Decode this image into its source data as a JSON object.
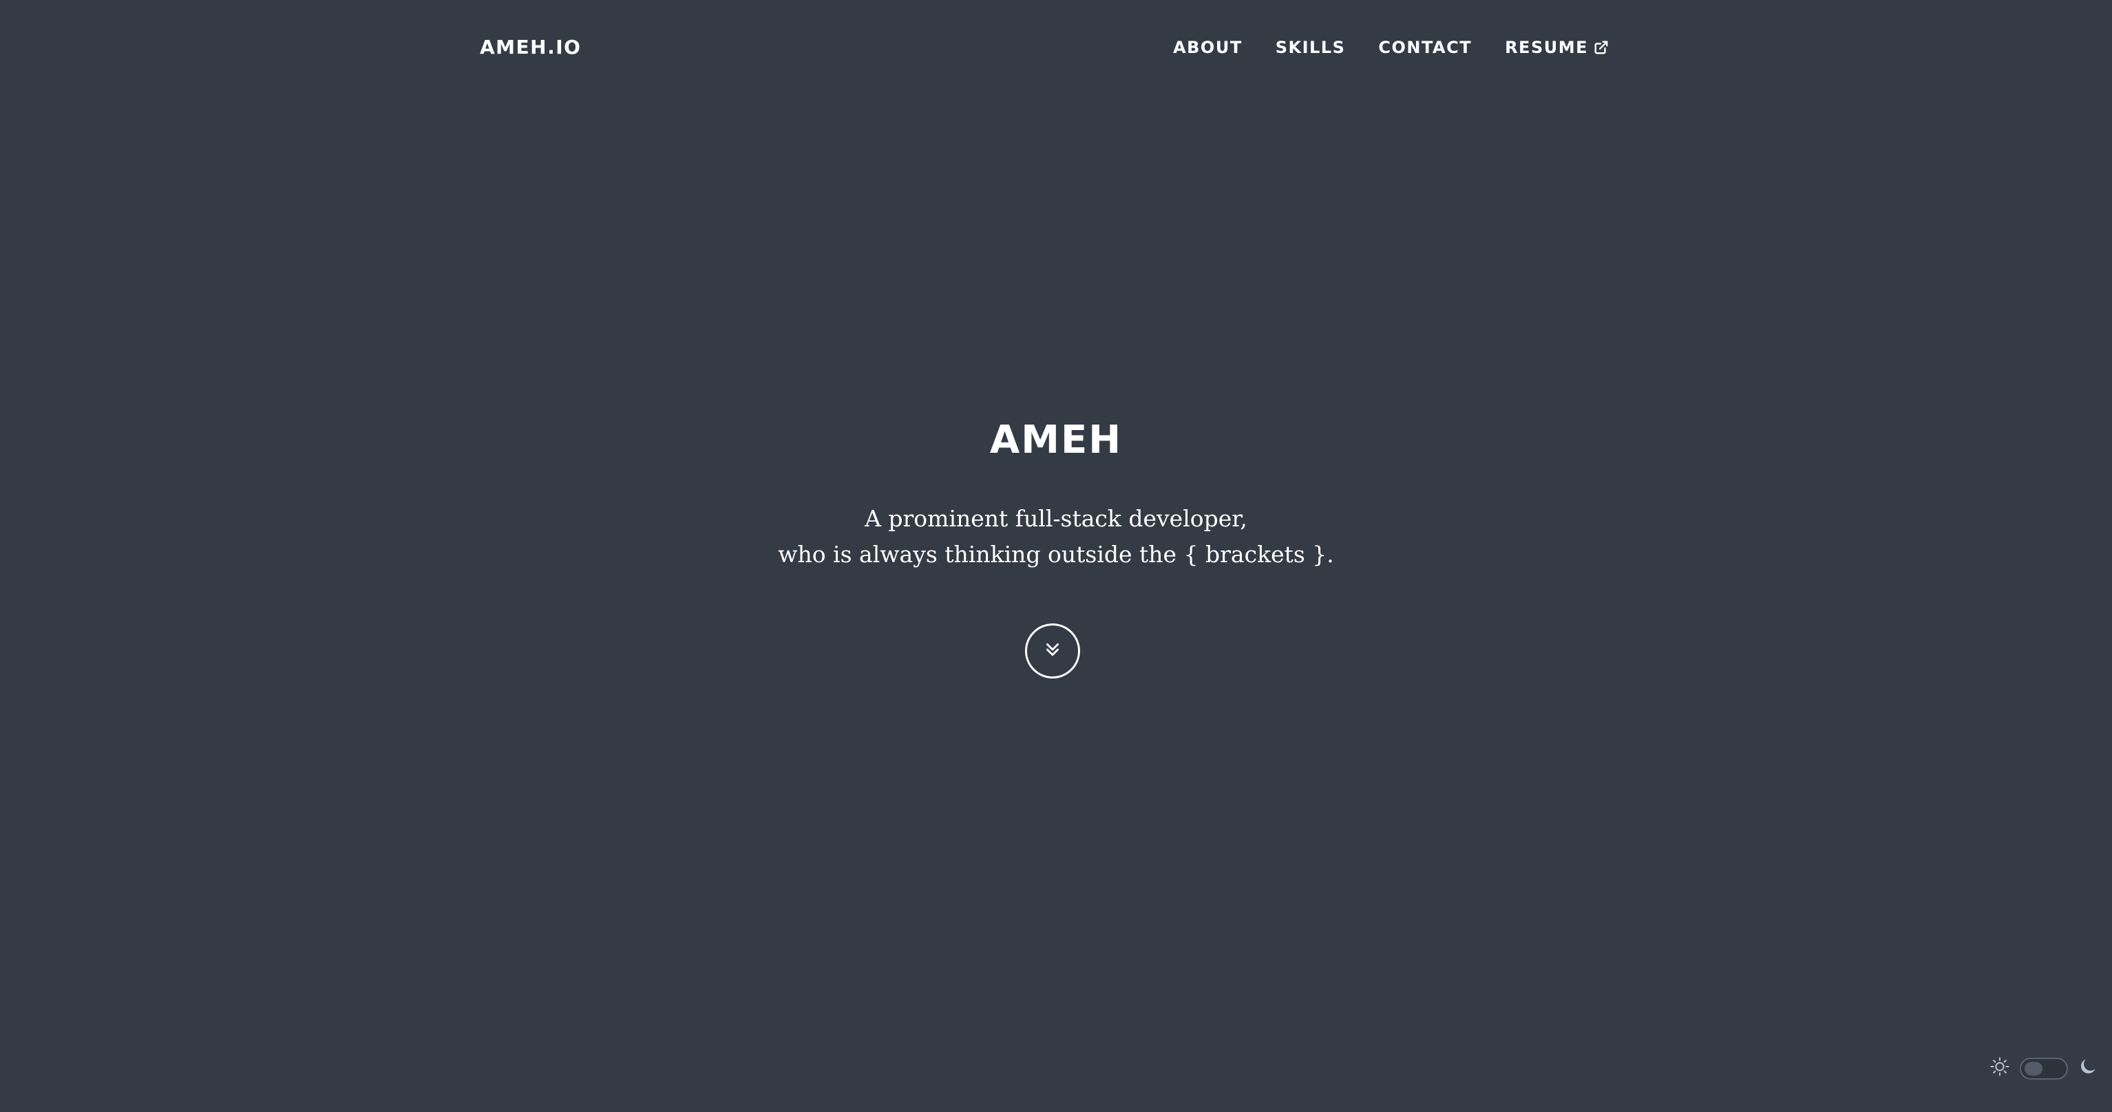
{
  "header": {
    "brand": "AMEH.IO",
    "nav": [
      {
        "label": "ABOUT"
      },
      {
        "label": "SKILLS"
      },
      {
        "label": "CONTACT"
      },
      {
        "label": "RESUME",
        "icon": "external-link-icon"
      }
    ]
  },
  "hero": {
    "title": "AMEH",
    "subtitle_line1": "A prominent full-stack developer,",
    "subtitle_line2": "who is always thinking outside the { brackets }.",
    "scroll_icon": "double-chevron-down-icon"
  },
  "theme_toggle": {
    "light_icon": "sun-icon",
    "dark_icon": "moon-icon",
    "mode": "dark"
  },
  "colors": {
    "background": "#353b45",
    "text": "#ffffff",
    "toggle_icon": "#b8c4d6"
  }
}
